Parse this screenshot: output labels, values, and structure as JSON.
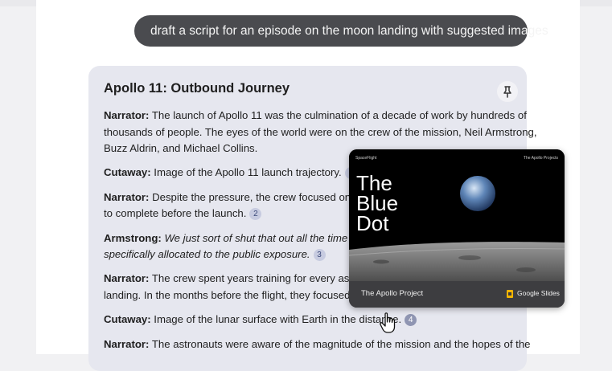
{
  "user_message": "draft a script for an episode on the moon landing with suggested images",
  "response": {
    "title": "Apollo 11: Outbound Journey",
    "lines": [
      {
        "segs": [
          {
            "b": "Narrator:"
          },
          {
            "t": " The launch of Apollo 11 was the culmination of a decade of work by hundreds of"
          }
        ]
      },
      {
        "segs": [
          {
            "t": "thousands of people. The eyes of the world were on the crew of the mission, Neil Armstrong,"
          }
        ]
      },
      {
        "segs": [
          {
            "t": "Buzz Aldrin, and Michael Collins."
          }
        ]
      },
      {
        "segs": [
          {
            "b": "Cutaway:"
          },
          {
            "t": " Image of the Apollo 11 launch trajectory."
          },
          {
            "c": "1"
          }
        ]
      },
      {
        "segs": [
          {
            "b": "Narrator:"
          },
          {
            "t": " Despite the pressure, the crew focused on their t"
          }
        ]
      },
      {
        "segs": [
          {
            "t": "to complete before the launch."
          },
          {
            "c": "2"
          }
        ]
      },
      {
        "segs": [
          {
            "b": "Armstrong:"
          },
          {
            "i": " We just sort of shut that out all the time that it"
          }
        ]
      },
      {
        "segs": [
          {
            "i": "specifically allocated to the public exposure."
          },
          {
            "c": "3"
          }
        ]
      },
      {
        "segs": [
          {
            "b": "Narrator:"
          },
          {
            "t": " The crew spent years training for every aspect of"
          }
        ]
      },
      {
        "segs": [
          {
            "t": "landing. In the months before the flight, they focused on th"
          }
        ]
      },
      {
        "segs": [
          {
            "b": "Cutaway:"
          },
          {
            "t": " Image of the lunar surface with Earth in the distance."
          },
          {
            "c": "4",
            "active": true
          }
        ]
      },
      {
        "segs": [
          {
            "b": "Narrator:"
          },
          {
            "t": " The astronauts were aware of the magnitude of the mission and the hopes of the"
          }
        ]
      }
    ]
  },
  "preview": {
    "slide_top_left": "SpaceFlight",
    "slide_top_right": "The Apollo Projects",
    "slide_title_lines": [
      "The",
      "Blue",
      "Dot"
    ],
    "footer_title": "The Apollo Project",
    "footer_app": "Google Slides"
  },
  "icons": {
    "pin": "pin-icon",
    "cursor": "hand-pointer-icon",
    "app": "google-slides-icon"
  },
  "colors": {
    "bubble": "#4a4b4f",
    "card": "#e6e7ef",
    "citation": "#c7cbe0",
    "slides": "#f4b400"
  }
}
